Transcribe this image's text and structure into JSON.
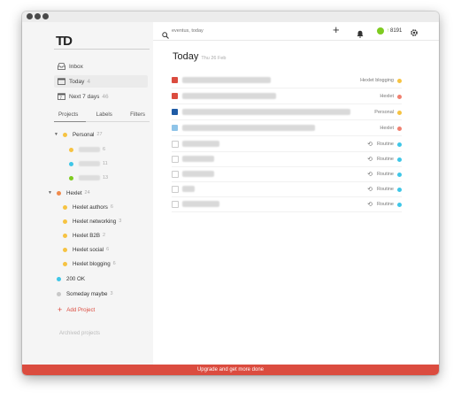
{
  "colors": {
    "brand_red": "#db4c3f",
    "yellow": "#f6c342",
    "orange": "#f08a4b",
    "cyan": "#3fc6e7",
    "green": "#7ecb20",
    "grey": "#c8c8c8",
    "salmon": "#f08070",
    "dark_blue": "#1f5ba5",
    "light_blue": "#8fc4e8"
  },
  "sidebar": {
    "logo": "TD",
    "nav": [
      {
        "label": "Inbox",
        "count": "",
        "icon": "inbox-icon"
      },
      {
        "label": "Today",
        "count": "4",
        "icon": "calendar-today-icon"
      },
      {
        "label": "Next 7 days",
        "count": "46",
        "icon": "calendar-week-icon"
      }
    ],
    "tabs": [
      "Projects",
      "Labels",
      "Filters"
    ],
    "personal": {
      "label": "Personal",
      "count": "27"
    },
    "personal_children_counts": [
      "6",
      "11",
      "13"
    ],
    "hexlet": {
      "label": "Hexlet",
      "count": "24"
    },
    "hexlet_children": [
      {
        "label": "Hexlet authors",
        "count": "6"
      },
      {
        "label": "Hexlet networking",
        "count": "3"
      },
      {
        "label": "Hexlet B2B",
        "count": "2"
      },
      {
        "label": "Hexlet social",
        "count": "6"
      },
      {
        "label": "Hexlet blogging",
        "count": "6"
      }
    ],
    "ok200": {
      "label": "200 OK",
      "count": ""
    },
    "someday": {
      "label": "Someday maybe",
      "count": "3"
    },
    "add_project": "Add Project",
    "archived": "Archived projects"
  },
  "topbar": {
    "search_placeholder": "eventus, today",
    "karma": "8191"
  },
  "main": {
    "title": "Today",
    "date": "Thu 26 Feb",
    "tasks": [
      {
        "project": "Hexlet blogging",
        "recurring": false
      },
      {
        "project": "Hexlet",
        "recurring": false
      },
      {
        "project": "Personal",
        "recurring": false
      },
      {
        "project": "Hexlet",
        "recurring": false
      },
      {
        "project": "Routine",
        "recurring": true
      },
      {
        "project": "Routine",
        "recurring": true
      },
      {
        "project": "Routine",
        "recurring": true
      },
      {
        "project": "Routine",
        "recurring": true
      },
      {
        "project": "Routine",
        "recurring": true
      }
    ]
  },
  "banner": "Upgrade and get more done"
}
